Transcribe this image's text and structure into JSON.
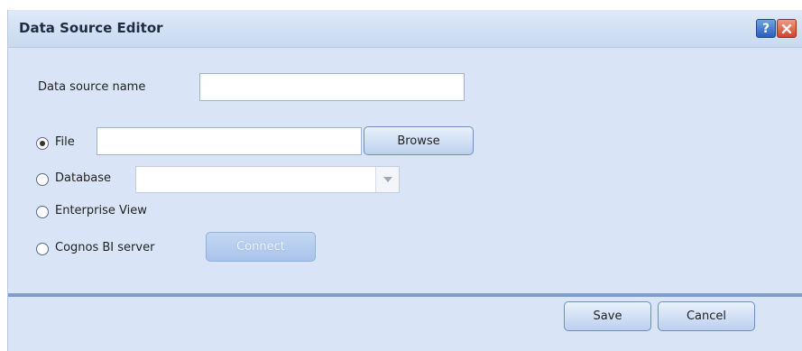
{
  "dialog": {
    "title": "Data Source Editor",
    "help_icon": "question-icon",
    "close_icon": "close-x-icon"
  },
  "form": {
    "name_label": "Data source name",
    "name_value": "",
    "options": {
      "file": {
        "label": "File",
        "checked": true,
        "value": "",
        "browse_label": "Browse"
      },
      "database": {
        "label": "Database",
        "checked": false,
        "selected": ""
      },
      "enterprise_view": {
        "label": "Enterprise View",
        "checked": false
      },
      "cognos": {
        "label": "Cognos BI server",
        "checked": false,
        "connect_label": "Connect"
      }
    }
  },
  "footer": {
    "save_label": "Save",
    "cancel_label": "Cancel"
  },
  "colors": {
    "dialog_bg": "#d9e5f6",
    "separator": "#7f9dd0",
    "button_border": "#6e8fbf"
  }
}
